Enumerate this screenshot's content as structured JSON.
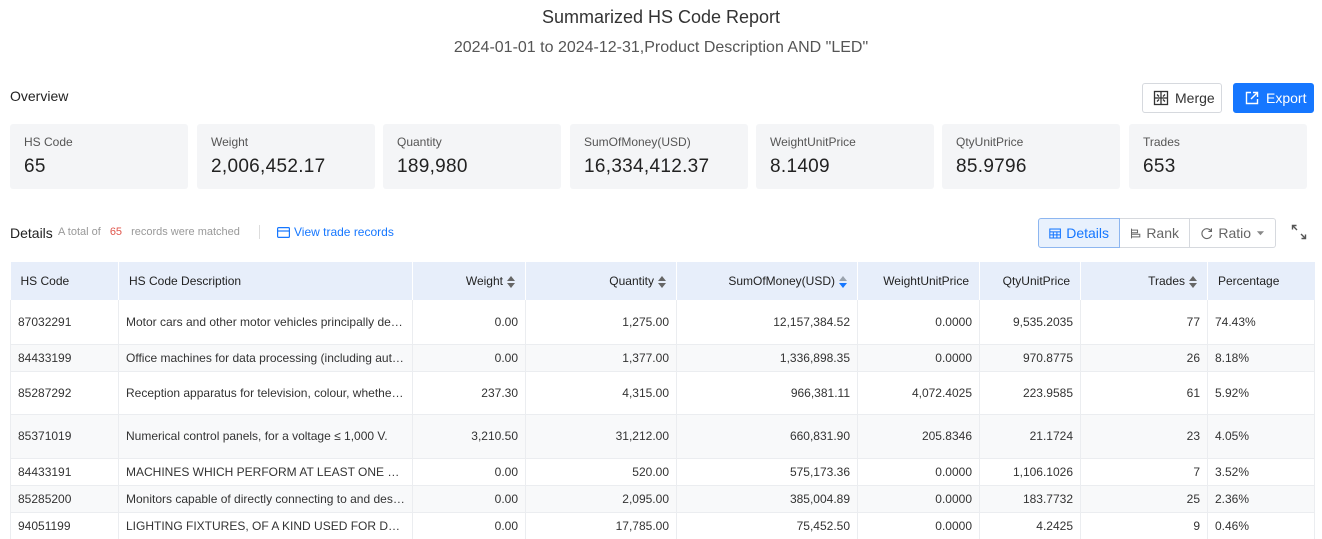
{
  "report": {
    "title": "Summarized HS Code Report",
    "subtitle": "2024-01-01 to 2024-12-31,Product Description AND \"LED\""
  },
  "overview": {
    "label": "Overview",
    "merge_label": "Merge",
    "export_label": "Export",
    "stats": [
      {
        "label": "HS Code",
        "value": "65"
      },
      {
        "label": "Weight",
        "value": "2,006,452.17"
      },
      {
        "label": "Quantity",
        "value": "189,980"
      },
      {
        "label": "SumOfMoney(USD)",
        "value": "16,334,412.37"
      },
      {
        "label": "WeightUnitPrice",
        "value": "8.1409"
      },
      {
        "label": "QtyUnitPrice",
        "value": "85.9796"
      },
      {
        "label": "Trades",
        "value": "653"
      }
    ]
  },
  "details": {
    "label": "Details",
    "note_prefix": "A total of",
    "count": "65",
    "note_suffix": "records were matched",
    "view_trade_label": "View trade records",
    "views": {
      "details": "Details",
      "rank": "Rank",
      "ratio": "Ratio"
    }
  },
  "table": {
    "columns": [
      "HS Code",
      "HS Code Description",
      "Weight",
      "Quantity",
      "SumOfMoney(USD)",
      "WeightUnitPrice",
      "QtyUnitPrice",
      "Trades",
      "Percentage"
    ],
    "rows": [
      [
        "87032291",
        "Motor cars and other motor vehicles principally designed for the transport of persons",
        "0.00",
        "1,275.00",
        "12,157,384.52",
        "0.0000",
        "9,535.2035",
        "77",
        "74.43%"
      ],
      [
        "84433199",
        "Office machines for data processing (including automatic data processing machines)",
        "0.00",
        "1,377.00",
        "1,336,898.35",
        "0.0000",
        "970.8775",
        "26",
        "8.18%"
      ],
      [
        "85287292",
        "Reception apparatus for television, colour, whether or not incorporating radio",
        "237.30",
        "4,315.00",
        "966,381.11",
        "4,072.4025",
        "223.9585",
        "61",
        "5.92%"
      ],
      [
        "85371019",
        "Numerical control panels, for a voltage ≤ 1,000 V.",
        "3,210.50",
        "31,212.00",
        "660,831.90",
        "205.8346",
        "21.1724",
        "23",
        "4.05%"
      ],
      [
        "84433191",
        "MACHINES WHICH PERFORM AT LEAST ONE OF THE FUNCTIONS OF PRINTING",
        "0.00",
        "520.00",
        "575,173.36",
        "0.0000",
        "1,106.1026",
        "7",
        "3.52%"
      ],
      [
        "85285200",
        "Monitors capable of directly connecting to and designed for use with an automatic data processing machine",
        "0.00",
        "2,095.00",
        "385,004.89",
        "0.0000",
        "183.7732",
        "25",
        "2.36%"
      ],
      [
        "94051199",
        "LIGHTING FIXTURES, OF A KIND USED FOR DOMESTIC PURPOSES",
        "0.00",
        "17,785.00",
        "75,452.50",
        "0.0000",
        "4.2425",
        "9",
        "0.46%"
      ]
    ]
  }
}
